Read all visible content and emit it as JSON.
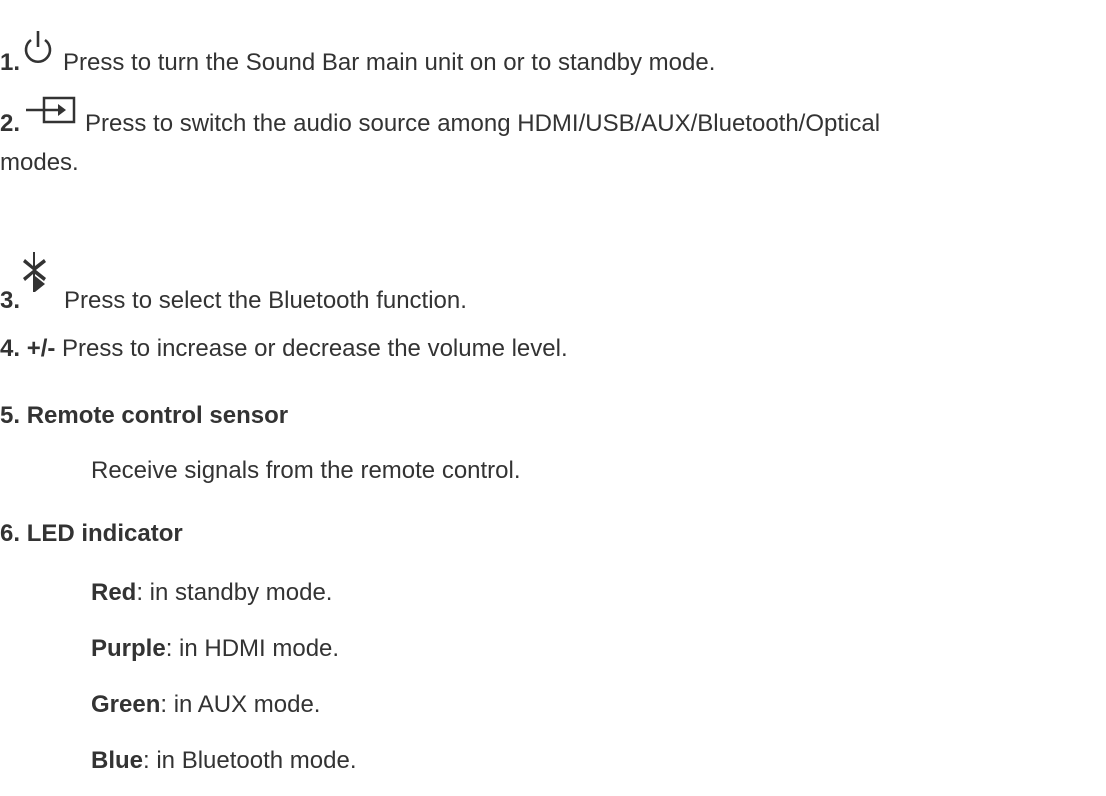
{
  "items": [
    {
      "num": "1.",
      "icon": "power-icon",
      "text": "Press to turn the Sound Bar main unit on or to standby mode."
    },
    {
      "num": "2.",
      "icon": "input-source-icon",
      "text": "Press to switch the audio source among HDMI/USB/AUX/Bluetooth/Optical",
      "text_cont": "modes."
    },
    {
      "num": "3.",
      "icon": "bluetooth-icon",
      "text": "Press to select the Bluetooth function."
    },
    {
      "num": "4.",
      "label": "+/-",
      "text": "Press to increase or decrease the volume level."
    },
    {
      "num": "5.",
      "label": "Remote control sensor",
      "detail": "Receive signals from the remote control."
    },
    {
      "num": "6.",
      "label": "LED indicator"
    }
  ],
  "led_states": [
    {
      "color": "Red",
      "desc": ": in standby mode."
    },
    {
      "color": "Purple",
      "desc": ": in HDMI mode."
    },
    {
      "color": "Green",
      "desc": ": in AUX mode."
    },
    {
      "color": "Blue",
      "desc": ": in Bluetooth mode."
    }
  ]
}
